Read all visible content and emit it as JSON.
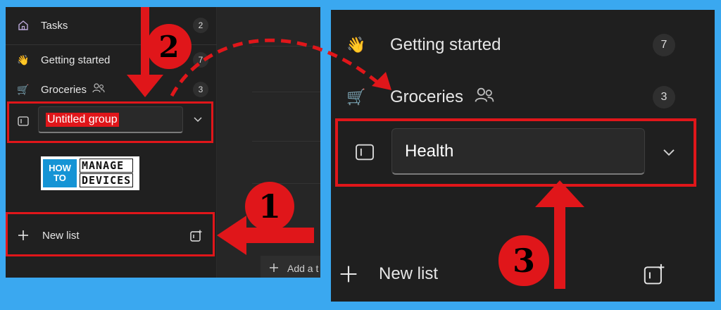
{
  "left": {
    "nav": {
      "tasks": {
        "label": "Tasks",
        "count": "2"
      },
      "getting_started": {
        "label": "Getting started",
        "count": "7",
        "emoji": "👋"
      },
      "groceries": {
        "label": "Groceries",
        "count": "3",
        "emoji": "🛒"
      }
    },
    "group_input_value": "Untitled group",
    "new_list_label": "New list",
    "add_task_label": "Add a t"
  },
  "right": {
    "nav": {
      "getting_started": {
        "label": "Getting started",
        "count": "7",
        "emoji": "👋"
      },
      "groceries": {
        "label": "Groceries",
        "count": "3",
        "emoji": "🛒"
      }
    },
    "group_input_value": "Health",
    "new_list_label": "New list"
  },
  "logo": {
    "how": "HOW",
    "to": "TO",
    "line1": "MANAGE",
    "line2": "DEVICES"
  },
  "steps": [
    "1",
    "2",
    "3"
  ],
  "colors": {
    "annotation": "#e0161a",
    "background": "#3aa8f0",
    "panel": "#202020"
  }
}
